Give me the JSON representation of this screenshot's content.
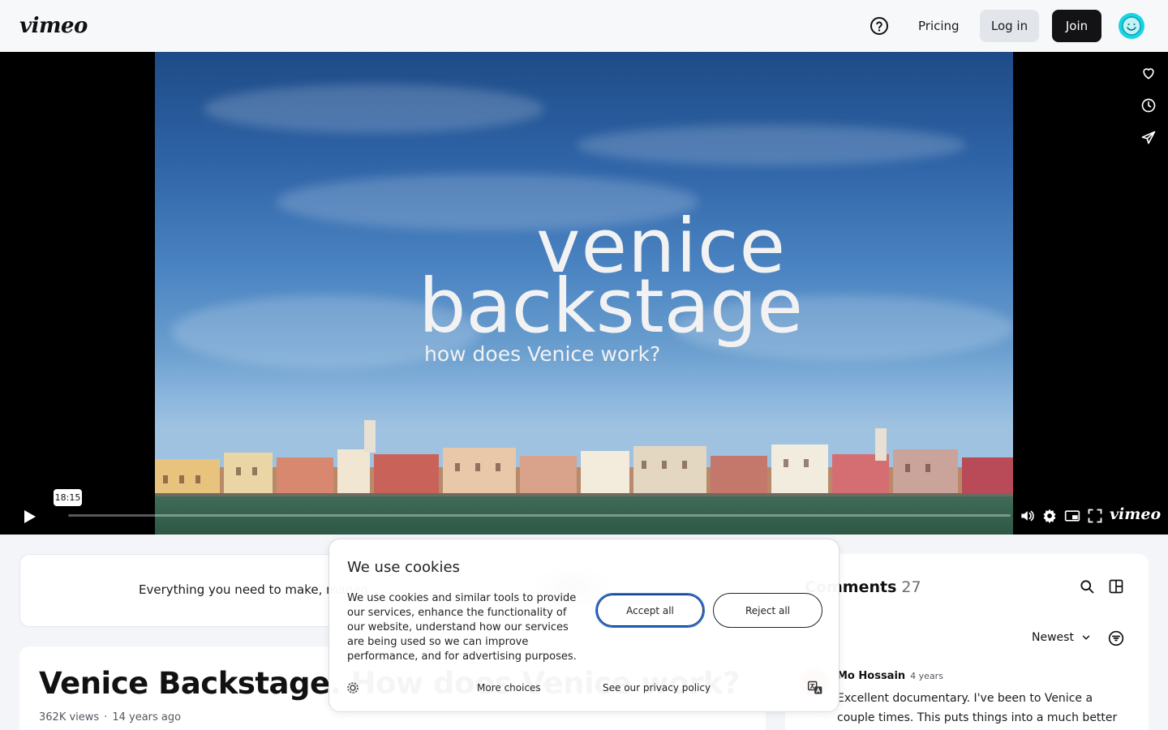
{
  "header": {
    "logo": "vimeo",
    "help_icon": "help-circle-icon",
    "pricing": "Pricing",
    "login": "Log in",
    "join": "Join",
    "avatar_color": "#17d4e4"
  },
  "player": {
    "title_line1": "venice",
    "title_line2": "backstage",
    "title_line3": "how does Venice work?",
    "time_tooltip": "18:15",
    "progress": 0,
    "side_actions": [
      "heart-icon",
      "clock-icon",
      "send-icon"
    ],
    "controls": [
      "play-icon",
      "volume-icon",
      "settings-icon",
      "pip-icon",
      "fullscreen-icon"
    ],
    "brand": "vimeo"
  },
  "promo": {
    "text": "Everything you need to make, manag"
  },
  "video": {
    "title": "Venice Backstage. How does Venice work?",
    "views": "362K views",
    "age": "14 years ago"
  },
  "comments": {
    "title": "Comments",
    "count": "27",
    "sort": "Newest",
    "items": [
      {
        "author": "Mo Hossain",
        "age": "4 years",
        "text": "Excellent documentary. I've been to Venice a couple times. This puts things into a much better"
      }
    ]
  },
  "cookie": {
    "title": "We use cookies",
    "text": "We use cookies and similar tools to provide our services, enhance the functionality of our website, understand how our services are being used so we can improve performance, and for advertising purposes.",
    "accept": "Accept all",
    "reject": "Reject all",
    "more": "More choices",
    "privacy": "See our privacy policy"
  },
  "colors": {
    "accent_blue": "#2b6fd6",
    "dark_button": "#131316"
  }
}
